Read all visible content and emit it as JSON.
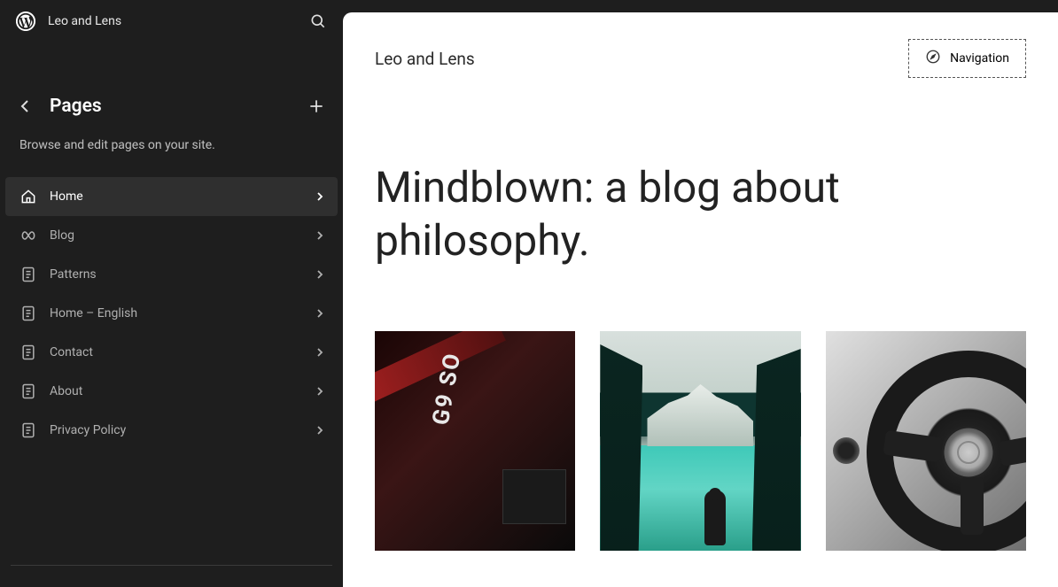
{
  "site": {
    "name": "Leo and Lens"
  },
  "sidebar": {
    "title": "Pages",
    "description": "Browse and edit pages on your site.",
    "items": [
      {
        "label": "Home",
        "icon": "home-icon",
        "active": true
      },
      {
        "label": "Blog",
        "icon": "loop-icon",
        "active": false
      },
      {
        "label": "Patterns",
        "icon": "page-icon",
        "active": false
      },
      {
        "label": "Home – English",
        "icon": "page-icon",
        "active": false
      },
      {
        "label": "Contact",
        "icon": "page-icon",
        "active": false
      },
      {
        "label": "About",
        "icon": "page-icon",
        "active": false
      },
      {
        "label": "Privacy Policy",
        "icon": "page-icon",
        "active": false
      }
    ]
  },
  "preview": {
    "site_title": "Leo and Lens",
    "navigation_label": "Navigation",
    "hero_title": "Mindblown: a blog about philosophy."
  }
}
